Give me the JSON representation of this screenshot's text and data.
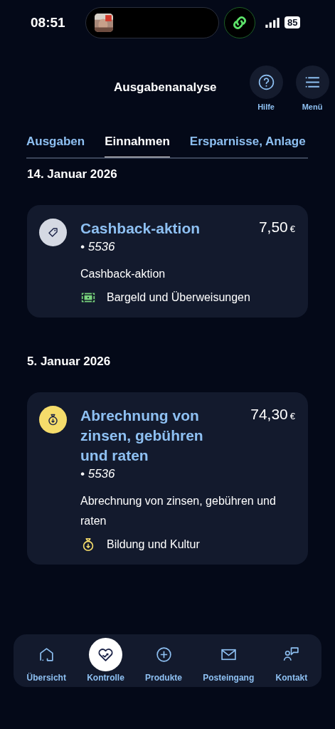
{
  "status_bar": {
    "time": "08:51",
    "battery": "85"
  },
  "header": {
    "title": "Ausgabenanalyse",
    "actions": [
      {
        "kind": "help",
        "label": "Hilfe"
      },
      {
        "kind": "menu",
        "label": "Menü"
      }
    ]
  },
  "tabs": [
    {
      "label": "Ausgaben",
      "selected": false
    },
    {
      "label": "Einnahmen",
      "selected": true
    },
    {
      "label": "Ersparnisse, Anlage",
      "selected": false
    }
  ],
  "groups": [
    {
      "date": "14. Januar 2026",
      "transactions": [
        {
          "kind": "tag",
          "color": "#d5d9e3",
          "title": "Cashback-aktion",
          "account": "• 5536",
          "amount": "7,50",
          "currency": "€",
          "description": "Cashback-aktion",
          "category": {
            "kind": "banknote",
            "label": "Bargeld und Überweisungen"
          }
        }
      ]
    },
    {
      "date": "5. Januar 2026",
      "transactions": [
        {
          "kind": "moneybag",
          "color": "#f5dc6b",
          "title": "Abrechnung von zinsen, gebühren und raten",
          "account": "• 5536",
          "amount": "74,30",
          "currency": "€",
          "description": "Abrechnung von zinsen, gebühren und raten",
          "category": {
            "kind": "moneybag",
            "label": "Bildung und Kultur"
          }
        }
      ]
    }
  ],
  "nav": [
    {
      "kind": "home",
      "label": "Übersicht",
      "selected": false
    },
    {
      "kind": "heart",
      "label": "Kontrolle",
      "selected": true
    },
    {
      "kind": "plus",
      "label": "Produkte",
      "selected": false
    },
    {
      "kind": "mail",
      "label": "Posteingang",
      "selected": false
    },
    {
      "kind": "contact",
      "label": "Kontakt",
      "selected": false
    }
  ]
}
